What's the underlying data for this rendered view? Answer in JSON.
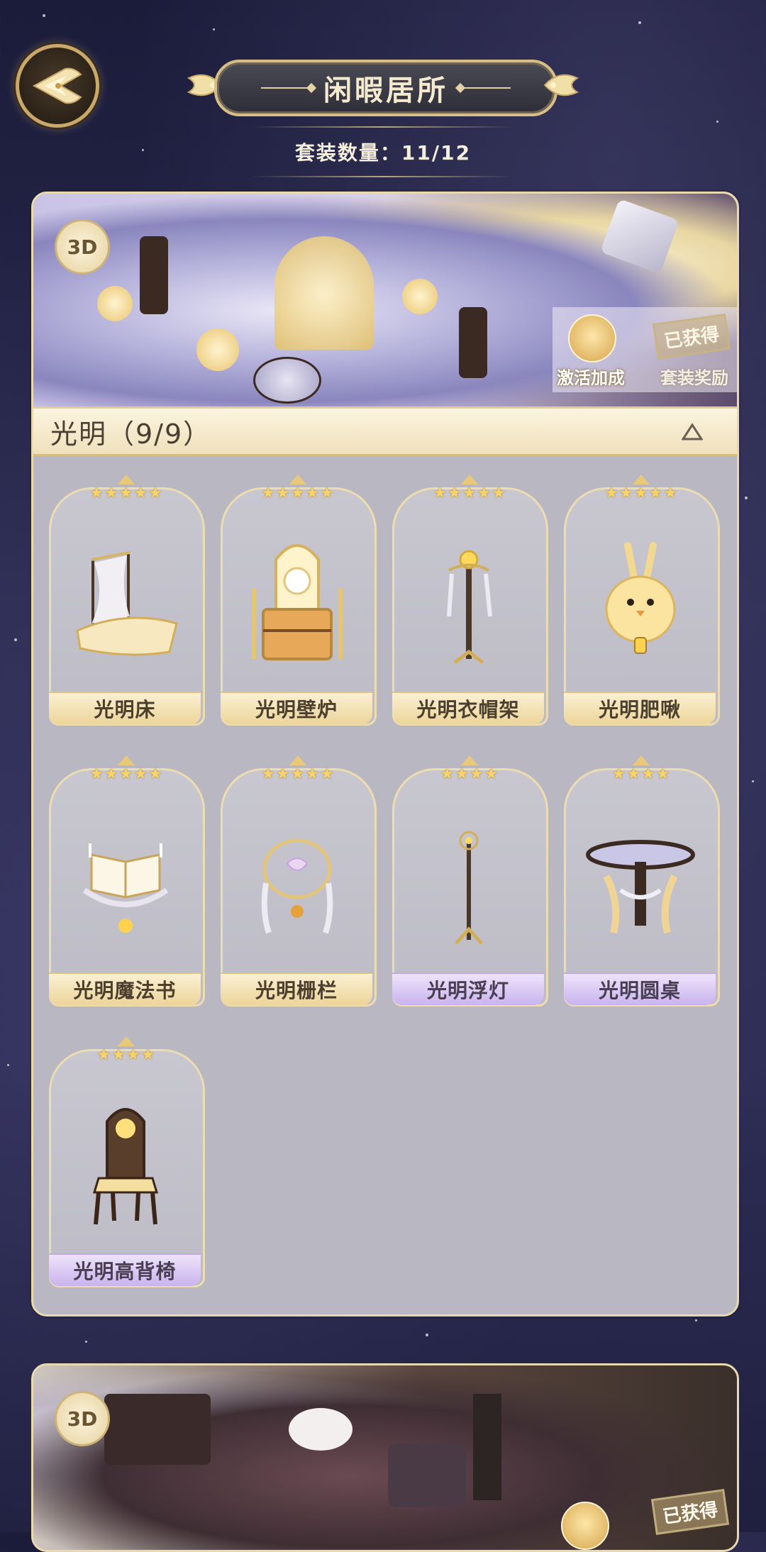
{
  "header": {
    "title": "闲暇居所",
    "suit_count_label": "套装数量：11/12"
  },
  "icons": {
    "back": "back-wing-icon",
    "collapse": "triangle-up-icon",
    "badge_3d": "3D"
  },
  "sets": [
    {
      "name": "光明（9/9）",
      "badge": "3D",
      "bonus_label": "激活加成",
      "status_stamp": "已获得",
      "status_sub": "套装奖励",
      "items": [
        {
          "name": "光明床",
          "stars": "★★★★★",
          "rarity": "gold"
        },
        {
          "name": "光明壁炉",
          "stars": "★★★★★",
          "rarity": "gold"
        },
        {
          "name": "光明衣帽架",
          "stars": "★★★★★",
          "rarity": "gold"
        },
        {
          "name": "光明肥啾",
          "stars": "★★★★★",
          "rarity": "gold"
        },
        {
          "name": "光明魔法书",
          "stars": "★★★★★",
          "rarity": "gold"
        },
        {
          "name": "光明栅栏",
          "stars": "★★★★★",
          "rarity": "gold"
        },
        {
          "name": "光明浮灯",
          "stars": "★★★★",
          "rarity": "purple"
        },
        {
          "name": "光明圆桌",
          "stars": "★★★★",
          "rarity": "purple"
        },
        {
          "name": "光明高背椅",
          "stars": "★★★★",
          "rarity": "purple"
        }
      ]
    },
    {
      "badge": "3D",
      "status_stamp": "已获得"
    }
  ],
  "colors": {
    "gold_label": "#ecd59a",
    "purple_label": "#c9b3ee",
    "frame_border": "#ecdcb2",
    "background": "#2a2b50"
  }
}
